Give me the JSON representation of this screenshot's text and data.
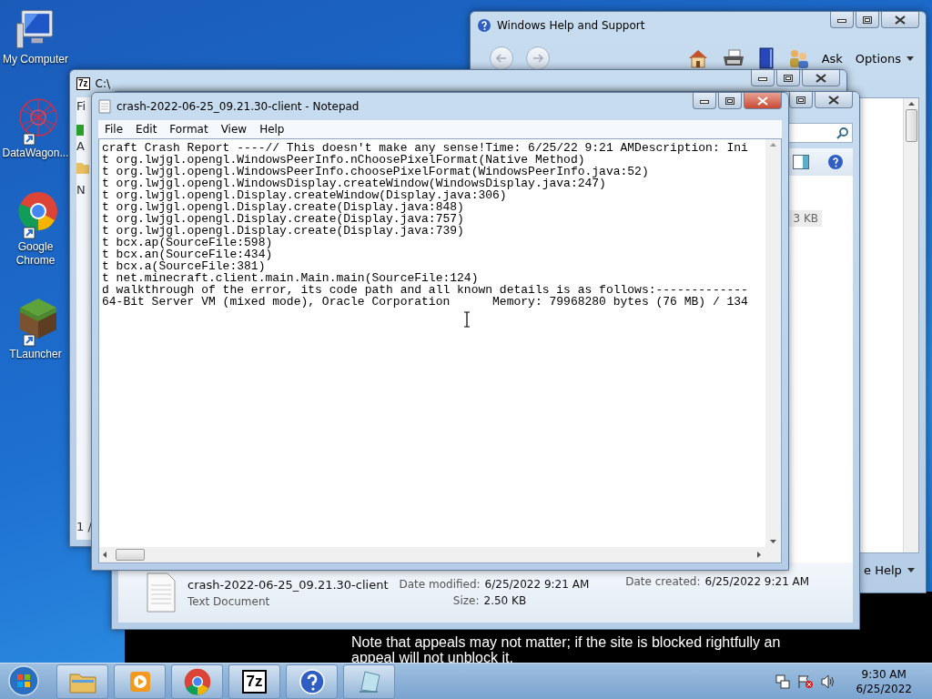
{
  "desktop_icons": [
    {
      "kind": "computer",
      "label": "My Computer"
    },
    {
      "kind": "network",
      "label": "DataWagon..."
    },
    {
      "kind": "browser",
      "label": "Google Chrome"
    },
    {
      "kind": "block",
      "label": "TLauncher"
    }
  ],
  "help_window": {
    "title": "Windows Help and Support",
    "ask": "Ask",
    "options": "Options",
    "footer": "e Help"
  },
  "archive_window": {
    "logo": "7z",
    "title": "C:\\",
    "menu": "Fi",
    "toolbar": "A",
    "header": "N",
    "status": "1 /"
  },
  "explorer_window": {
    "size_cell": "3 KB",
    "details": {
      "file_name": "crash-2022-06-25_09.21.30-client",
      "file_type": "Text Document",
      "modified_label": "Date modified:",
      "modified_value": "6/25/2022 9:21 AM",
      "size_label": "Size:",
      "size_value": "2.50 KB",
      "created_label": "Date created:",
      "created_value": "6/25/2022 9:21 AM"
    }
  },
  "notepad": {
    "title": "crash-2022-06-25_09.21.30-client - Notepad",
    "menu": [
      "File",
      "Edit",
      "Format",
      "View",
      "Help"
    ],
    "lines": [
      "craft Crash Report ----// This doesn't make any sense!Time: 6/25/22 9:21 AMDescription: Ini",
      "t org.lwjgl.opengl.WindowsPeerInfo.nChoosePixelFormat(Native Method)",
      "t org.lwjgl.opengl.WindowsPeerInfo.choosePixelFormat(WindowsPeerInfo.java:52)",
      "t org.lwjgl.opengl.WindowsDisplay.createWindow(WindowsDisplay.java:247)",
      "t org.lwjgl.opengl.Display.createWindow(Display.java:306)",
      "t org.lwjgl.opengl.Display.create(Display.java:848)",
      "t org.lwjgl.opengl.Display.create(Display.java:757)",
      "t org.lwjgl.opengl.Display.create(Display.java:739)",
      "t bcx.ap(SourceFile:598)",
      "t bcx.an(SourceFile:434)",
      "t bcx.a(SourceFile:381)",
      "t net.minecraft.client.main.Main.main(SourceFile:124)",
      "d walkthrough of the error, its code path and all known details is as follows:-------------",
      "64-Bit Server VM (mixed mode), Oracle Corporation      Memory: 79968280 bytes (76 MB) / 134"
    ]
  },
  "caption": "Note that appeals may not matter; if the site is blocked rightfully an appeal will not unblock it.",
  "taskbar": {
    "apps": [
      {
        "kind": "folder"
      },
      {
        "kind": "media"
      },
      {
        "kind": "browser"
      },
      {
        "kind": "archive",
        "label": "7z"
      },
      {
        "kind": "help"
      },
      {
        "kind": "notepad"
      }
    ],
    "time": "9:30 AM",
    "date": "6/25/2022"
  }
}
